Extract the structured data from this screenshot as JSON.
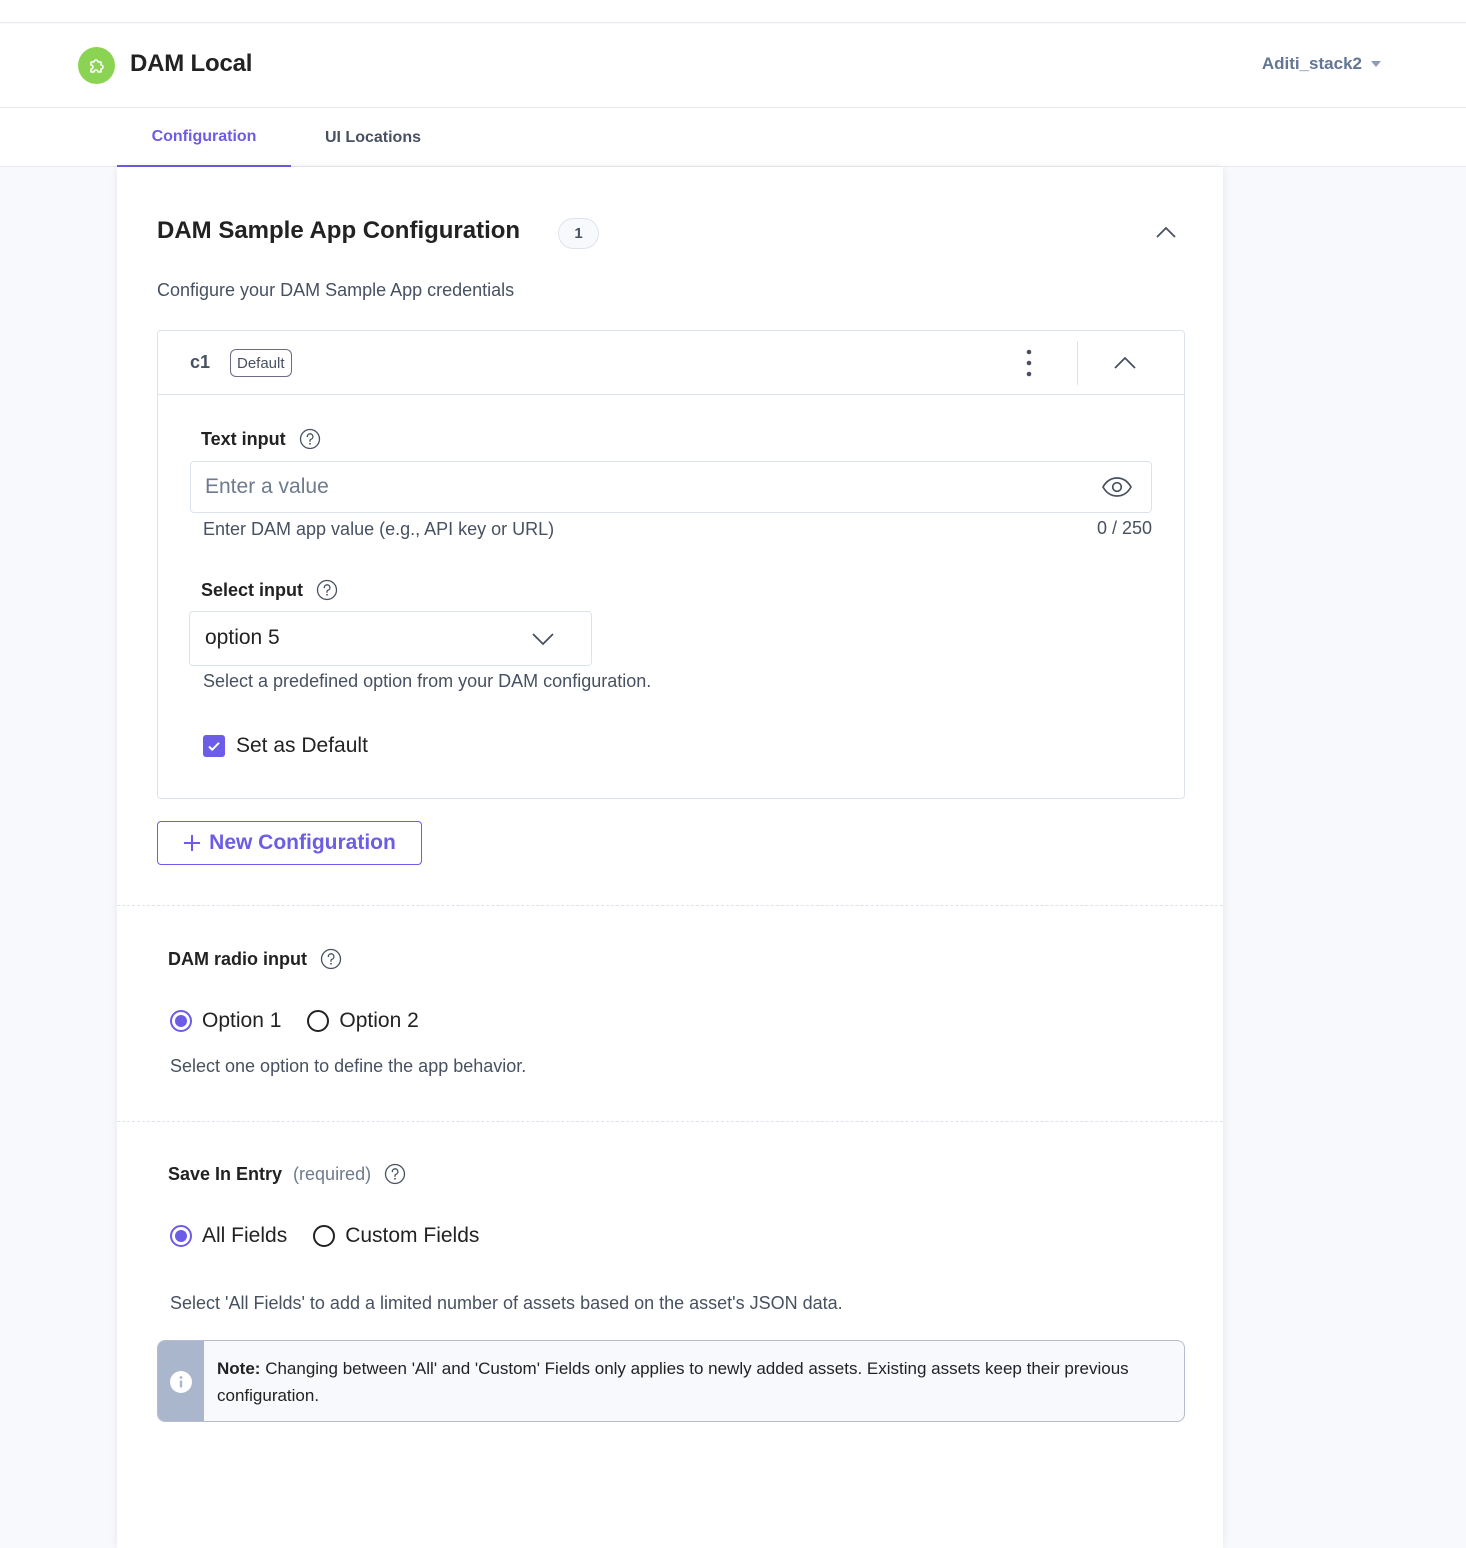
{
  "app": {
    "title": "DAM Local",
    "stack_name": "Aditi_stack2",
    "logo_icon": "puzzle-icon"
  },
  "tabs": [
    {
      "label": "Configuration",
      "active": true
    },
    {
      "label": "UI Locations",
      "active": false
    }
  ],
  "section": {
    "title": "DAM Sample App Configuration",
    "count": "1",
    "description": "Configure your DAM Sample App credentials"
  },
  "config_card": {
    "name": "c1",
    "badge": "Default",
    "text_input": {
      "label": "Text input",
      "placeholder": "Enter a value",
      "value": "",
      "helper": "Enter DAM app value (e.g., API key or URL)",
      "counter": "0 / 250"
    },
    "select_input": {
      "label": "Select input",
      "value": "option 5",
      "helper": "Select a predefined option from your DAM configuration."
    },
    "set_default": {
      "label": "Set as Default",
      "checked": true
    }
  },
  "new_config_button": {
    "icon": "plus-icon",
    "label": "New Configuration"
  },
  "radio_section": {
    "label": "DAM radio input",
    "options": [
      {
        "label": "Option 1",
        "selected": true
      },
      {
        "label": "Option 2",
        "selected": false
      }
    ],
    "helper": "Select one option to define the app behavior."
  },
  "save_in_entry": {
    "label": "Save In Entry",
    "required_text": "(required)",
    "options": [
      {
        "label": "All Fields",
        "selected": true
      },
      {
        "label": "Custom Fields",
        "selected": false
      }
    ],
    "helper": "Select 'All Fields' to add a limited number of assets based on the asset's JSON data."
  },
  "note": {
    "title": "Note:",
    "text": "Changing between 'All' and 'Custom' Fields only applies to newly added assets. Existing assets keep their previous configuration."
  },
  "colors": {
    "accent": "#6c5ce7",
    "logo_green": "#8bd453",
    "text_dark": "#222222",
    "text_muted": "#475161",
    "border": "#dde3ee",
    "note_side": "#a9b6cb"
  }
}
